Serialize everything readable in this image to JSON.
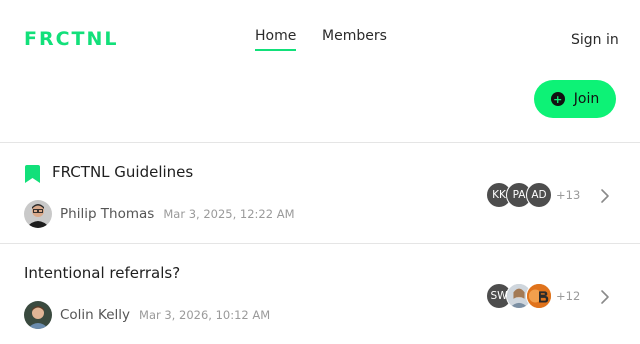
{
  "header": {
    "logo": "FRCTNL",
    "nav": [
      {
        "label": "Home",
        "active": true
      },
      {
        "label": "Members",
        "active": false
      }
    ],
    "sign_in": "Sign in"
  },
  "actions": {
    "join_label": "Join",
    "join_icon": "plus-circle-icon"
  },
  "colors": {
    "accent": "#0df276",
    "logo": "#12e07a",
    "avatar_initials_bg": "#4d4d4d"
  },
  "threads": [
    {
      "title": "FRCTNL Guidelines",
      "pinned": true,
      "pin_icon": "bookmark-icon",
      "author": "Philip Thomas",
      "timestamp": "Mar 3, 2025, 12:22 AM",
      "participants": [
        "KK",
        "PA",
        "AD"
      ],
      "more_count": "+13"
    },
    {
      "title": "Intentional referrals?",
      "pinned": false,
      "author": "Colin Kelly",
      "timestamp": "Mar 3, 2026, 10:12 AM",
      "participants": [
        "SW"
      ],
      "more_count": "+12"
    }
  ]
}
